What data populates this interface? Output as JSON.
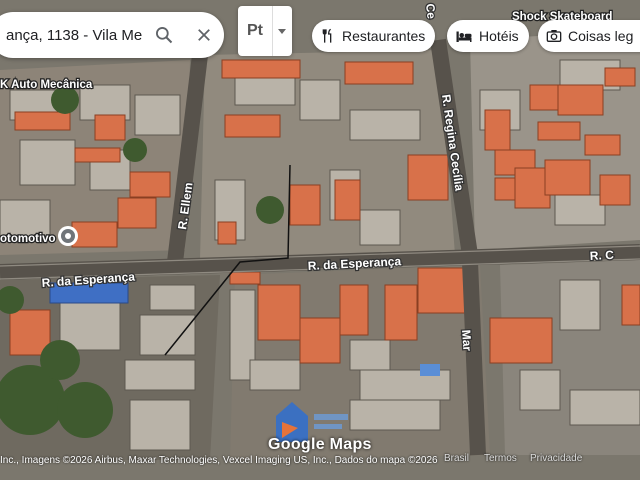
{
  "search": {
    "value": "ança, 1138 - Vila Me",
    "search_icon": "search-icon",
    "close_icon": "close-icon"
  },
  "language": {
    "label": "Pt",
    "caret_icon": "caret-down-icon"
  },
  "chips": [
    {
      "label": "Restaurantes",
      "icon": "fork-knife-icon"
    },
    {
      "label": "Hotéis",
      "icon": "bed-icon"
    },
    {
      "label": "Coisas leg",
      "icon": "camera-icon"
    }
  ],
  "roads": {
    "esperanca_main": "R. da Esperança",
    "esperanca_left": "R. da Esperança",
    "ellem": "R. Ellem",
    "regina": "R. Regina Cecília",
    "ce": "Ce",
    "r_right": "R. C",
    "mar": "Mar"
  },
  "pois": {
    "auto_mecanica": "K Auto Mecânica",
    "automotivo": "otomotivo",
    "shock": "Shock Skateboard"
  },
  "footer": {
    "attribution": "Inc., Imagens ©2026 Airbus, Maxar Technologies, Vexcel Imaging US, Inc., Dados do mapa ©2026",
    "brasil": "Brasil",
    "termos": "Termos",
    "privacidade": "Privacidade",
    "logo": "Google Maps"
  },
  "colors": {
    "roof_tile": "#d8714a",
    "accent_blue": "#1a73e8"
  }
}
